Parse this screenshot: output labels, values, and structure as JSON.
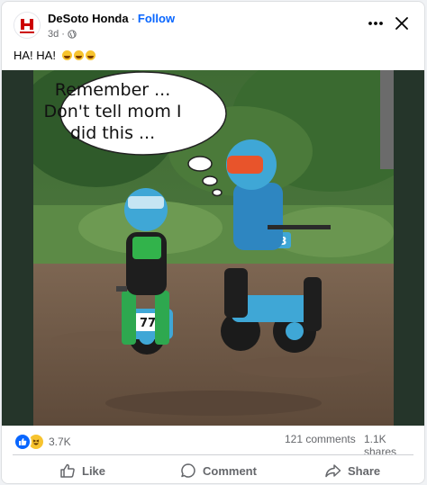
{
  "header": {
    "page_name": "DeSoto Honda",
    "separator": "·",
    "follow_label": "Follow",
    "time_ago": "3d",
    "privacy_icon": "globe-icon",
    "more_icon": "more-horizontal-icon",
    "close_icon": "close-icon"
  },
  "post": {
    "text": "HA! HA!",
    "emojis": [
      "rofl-emoji",
      "rofl-emoji",
      "rofl-emoji"
    ],
    "image": {
      "caption_lines": [
        "Remember ...",
        "Don't tell mom I",
        "did this ..."
      ],
      "rider_left_number": "77",
      "rider_right_number": "953"
    }
  },
  "stats": {
    "reaction_icons": [
      "like-reaction-icon",
      "haha-reaction-icon"
    ],
    "reactions_count": "3.7K",
    "comments": "121 comments",
    "shares": "1.1K shares"
  },
  "actions": [
    {
      "label": "Like",
      "icon": "thumbs-up-icon"
    },
    {
      "label": "Comment",
      "icon": "comment-icon"
    },
    {
      "label": "Share",
      "icon": "share-icon"
    }
  ],
  "colors": {
    "accent": "#0866ff",
    "text": "#050505",
    "secondary_text": "#65676b",
    "honda_red": "#cc0000"
  }
}
